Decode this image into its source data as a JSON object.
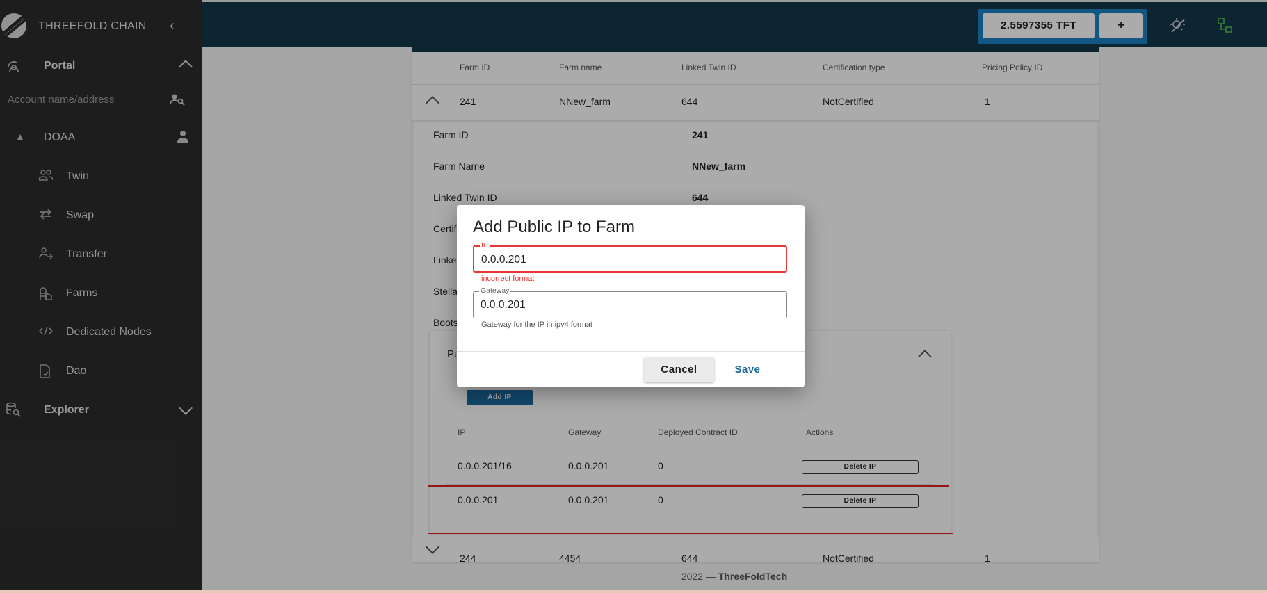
{
  "sidebar": {
    "brand": "THREEFOLD CHAIN",
    "portal": {
      "label": "Portal"
    },
    "account_placeholder": "Account name/address",
    "account": {
      "label": "DOAA"
    },
    "items": [
      {
        "label": "Twin"
      },
      {
        "label": "Swap"
      },
      {
        "label": "Transfer"
      },
      {
        "label": "Farms"
      },
      {
        "label": "Dedicated Nodes"
      },
      {
        "label": "Dao"
      }
    ],
    "explorer": {
      "label": "Explorer"
    }
  },
  "topbar": {
    "balance": "2.5597355 TFT",
    "plus": "+"
  },
  "farms_table": {
    "headers": [
      "Farm ID",
      "Farm name",
      "Linked Twin ID",
      "Certification type",
      "Pricing Policy ID"
    ],
    "rows": [
      {
        "farm_id": "241",
        "farm_name": "NNew_farm",
        "twin_id": "644",
        "cert": "NotCertified",
        "pricing": "1"
      },
      {
        "farm_id": "244",
        "farm_name": "4454",
        "twin_id": "644",
        "cert": "NotCertified",
        "pricing": "1"
      }
    ]
  },
  "details": {
    "farm_id_label": "Farm ID",
    "farm_id_value": "241",
    "farm_name_label": "Farm Name",
    "farm_name_value": "NNew_farm",
    "linked_twin_label": "Linked Twin ID",
    "linked_twin_value": "644",
    "cert_label_partial": "Certifi",
    "linked_label_partial": "Linked",
    "stellar_label_partial": "Stellar",
    "boots_label_partial": "Boots"
  },
  "public_ips": {
    "title_partial": "Pu",
    "add_button": "Add IP",
    "headers": [
      "IP",
      "Gateway",
      "Deployed Contract ID",
      "Actions"
    ],
    "rows": [
      {
        "ip": "0.0.0.201/16",
        "gateway": "0.0.0.201",
        "contract": "0",
        "action": "Delete IP"
      },
      {
        "ip": "0.0.0.201",
        "gateway": "0.0.0.201",
        "contract": "0",
        "action": "Delete IP"
      }
    ]
  },
  "footer": {
    "year": "2022 — ",
    "brand": "ThreeFoldTech"
  },
  "dialog": {
    "title": "Add Public IP to Farm",
    "ip_legend": "IP",
    "ip_value": "0.0.0.201",
    "ip_error": "incorrect format",
    "gateway_legend": "Gateway",
    "gateway_value": "0.0.0.201",
    "gateway_hint": "Gateway for the IP in ipv4 format",
    "cancel": "Cancel",
    "save": "Save"
  },
  "colors": {
    "topbar": "#13384a",
    "sidebar": "#2c2c2c",
    "accent": "#1b82c4",
    "error": "#e53935",
    "annotation_line": "#e02020"
  }
}
